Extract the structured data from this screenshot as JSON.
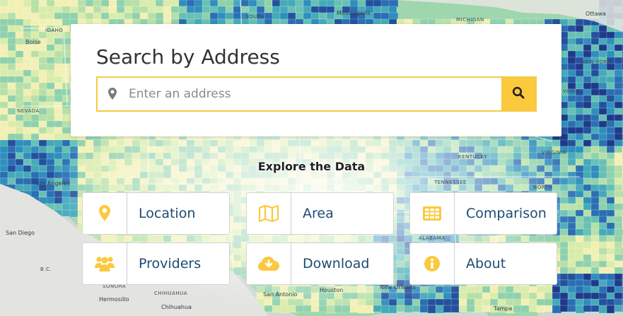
{
  "map": {
    "labels": {
      "idaho": "IDAHO",
      "nevada": "NEVADA",
      "south": "SOUTH",
      "minneapolis": "Minneapolis",
      "michigan": "MICHIGAN",
      "ottawa": "Ottawa",
      "new_york": "NEW YORK",
      "vania": "VANIA",
      "kentucky": "KENTUCKY",
      "virginia": "VIRGINIA",
      "tennessee": "TENNESSEE",
      "north": "NORTH",
      "los_angeles": "Los Angeles",
      "san_diego": "San Diego",
      "bc": "B.C.",
      "sonora": "SONORA",
      "hermosillo": "Hermosillo",
      "chihuahua_state": "CHIHUAHUA",
      "chihuahua_city": "Chihuahua",
      "san_antonio": "San Antonio",
      "houston": "Houston",
      "new_orleans": "New Orleans",
      "alabama": "ALABAMA",
      "tampa": "Tampa",
      "boise": "Boise"
    },
    "colors": [
      "#f2f0b4",
      "#d9ecab",
      "#b7e0a8",
      "#8fd1ad",
      "#67c0b4",
      "#45a9ba",
      "#2f8ebd",
      "#2a6fb3",
      "#24519e",
      "#1f3a8a"
    ]
  },
  "search": {
    "title": "Search by Address",
    "placeholder": "Enter an address",
    "icon": "map-marker-icon",
    "button_icon": "search-icon"
  },
  "explore": {
    "title": "Explore the Data",
    "tiles": [
      {
        "label": "Location",
        "icon": "map-marker-icon"
      },
      {
        "label": "Area",
        "icon": "map-icon"
      },
      {
        "label": "Comparison",
        "icon": "table-icon"
      },
      {
        "label": "Providers",
        "icon": "users-icon"
      },
      {
        "label": "Download",
        "icon": "cloud-download-icon"
      },
      {
        "label": "About",
        "icon": "info-circle-icon"
      }
    ]
  },
  "accent_color": "#fbc93d",
  "link_color": "#1d4a73"
}
